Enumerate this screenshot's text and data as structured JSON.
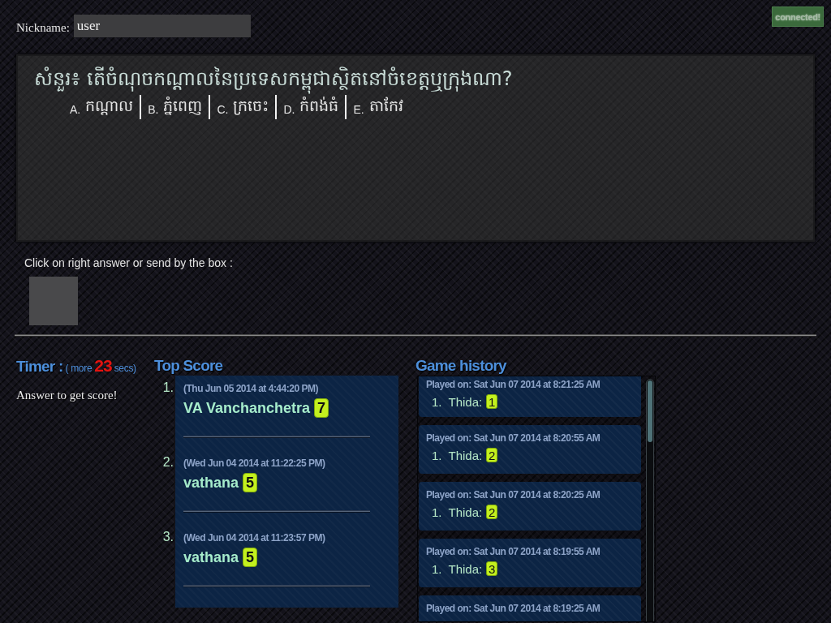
{
  "nickname": {
    "label": "Nickname:",
    "value": "user"
  },
  "connection_status": "connected!",
  "question": {
    "text": "សំនួរ៖  តើចំណុចកណ្តាលនៃប្រទេសកម្ពុជាស្ថិតនៅចំខេត្តឬក្រុងណា?",
    "answers": [
      {
        "letter": "A.",
        "text": "កណ្តាល"
      },
      {
        "letter": "B.",
        "text": "ភ្នំពេញ"
      },
      {
        "letter": "C.",
        "text": "ក្រចេះ"
      },
      {
        "letter": "D.",
        "text": "កំពង់ធំ"
      },
      {
        "letter": "E.",
        "text": "តាកែវ"
      }
    ]
  },
  "answer_prompt": "Click on right answer or send by the box :",
  "timer": {
    "label": "Timer :",
    "prefix": "( more",
    "seconds": "23",
    "suffix": "secs)",
    "message": "Answer to get score!"
  },
  "top_score": {
    "title": "Top Score",
    "entries": [
      {
        "rank": "1.",
        "date": "(Thu Jun 05 2014 at 4:44:20 PM)",
        "name": "VA Vanchanchetra",
        "score": "7"
      },
      {
        "rank": "2.",
        "date": "(Wed Jun 04 2014 at 11:22:25 PM)",
        "name": "vathana",
        "score": "5"
      },
      {
        "rank": "3.",
        "date": "(Wed Jun 04 2014 at 11:23:57 PM)",
        "name": "vathana",
        "score": "5"
      }
    ]
  },
  "game_history": {
    "title": "Game history",
    "games": [
      {
        "played_on": "Played on: Sat Jun 07 2014 at 8:21:25 AM",
        "players": [
          {
            "rank": "1.",
            "name": "Thida:",
            "score": "1"
          }
        ]
      },
      {
        "played_on": "Played on: Sat Jun 07 2014 at 8:20:55 AM",
        "players": [
          {
            "rank": "1.",
            "name": "Thida:",
            "score": "2"
          }
        ]
      },
      {
        "played_on": "Played on: Sat Jun 07 2014 at 8:20:25 AM",
        "players": [
          {
            "rank": "1.",
            "name": "Thida:",
            "score": "2"
          }
        ]
      },
      {
        "played_on": "Played on: Sat Jun 07 2014 at 8:19:55 AM",
        "players": [
          {
            "rank": "1.",
            "name": "Thida:",
            "score": "3"
          }
        ]
      },
      {
        "played_on": "Played on: Sat Jun 07 2014 at 8:19:25 AM"
      }
    ]
  }
}
